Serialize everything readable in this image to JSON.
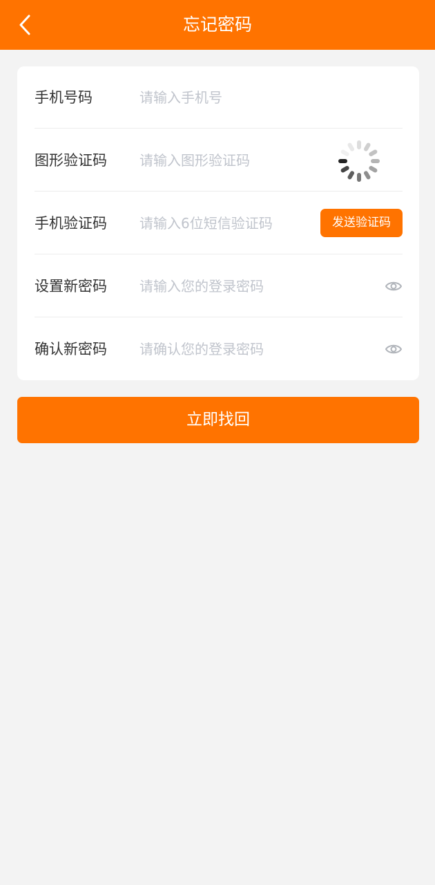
{
  "header": {
    "title": "忘记密码",
    "back_icon": "chevron-left-icon"
  },
  "form": {
    "phone": {
      "label": "手机号码",
      "placeholder": "请输入手机号",
      "value": ""
    },
    "captcha": {
      "label": "图形验证码",
      "placeholder": "请输入图形验证码",
      "value": "",
      "image_icon": "loading-spinner-icon"
    },
    "sms_code": {
      "label": "手机验证码",
      "placeholder": "请输入6位短信验证码",
      "value": "",
      "send_label": "发送验证码"
    },
    "new_password": {
      "label": "设置新密码",
      "placeholder": "请输入您的登录密码",
      "value": "",
      "toggle_icon": "eye-icon"
    },
    "confirm_password": {
      "label": "确认新密码",
      "placeholder": "请确认您的登录密码",
      "value": "",
      "toggle_icon": "eye-icon"
    }
  },
  "submit_label": "立即找回",
  "colors": {
    "accent": "#ff7300",
    "background": "#f3f3f3",
    "placeholder": "#c0c4cc",
    "label": "#333333"
  }
}
